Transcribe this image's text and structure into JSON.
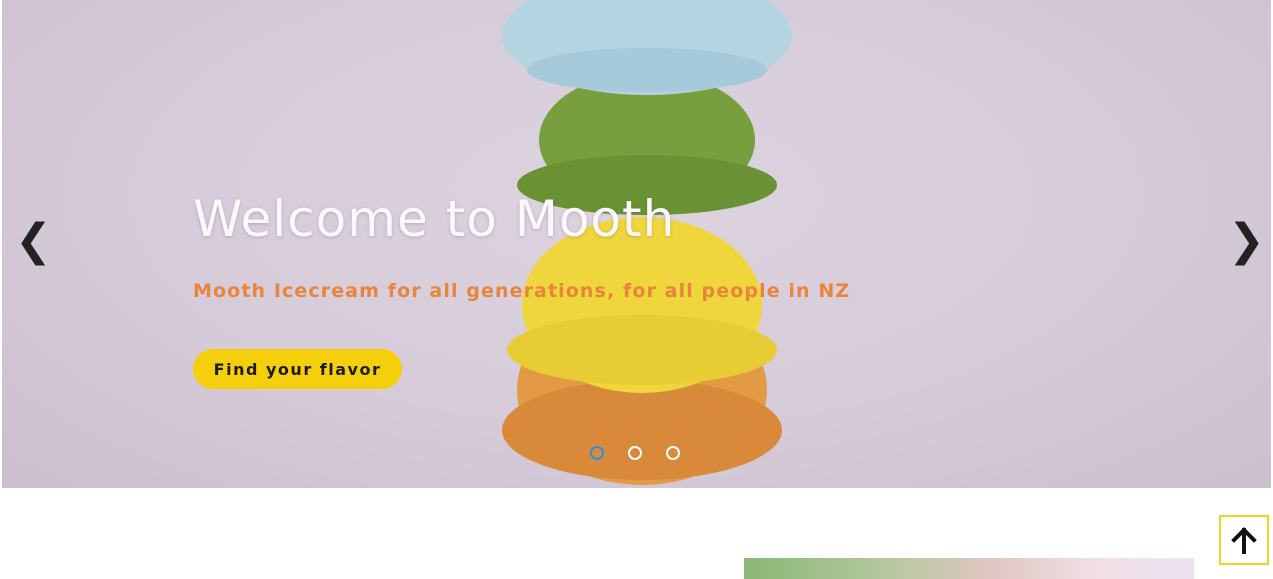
{
  "hero": {
    "title": "Welcome to Mooth",
    "subtitle": "Mooth Icecream for all generations, for all people in NZ",
    "cta_label": "Find your flavor",
    "prev_arrow": "❮",
    "next_arrow": "❯",
    "slide_count": 3,
    "active_slide": 1
  },
  "back_to_top": {
    "icon": "arrow-up-icon"
  },
  "colors": {
    "subtitle": "#e8843c",
    "cta_background": "#f5cf0b",
    "active_dot": "#2f8fd8",
    "back_to_top_border": "#f3d125"
  }
}
